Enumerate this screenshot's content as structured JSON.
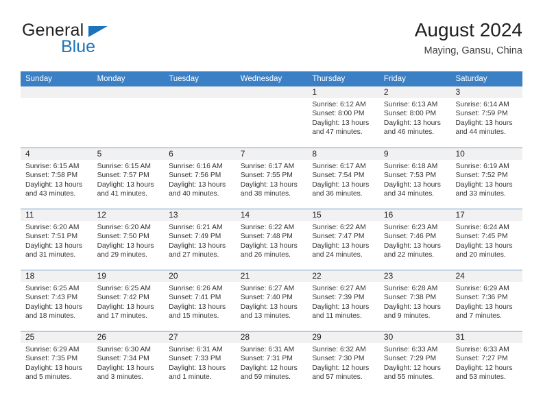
{
  "brand": {
    "name_top": "General",
    "name_bottom": "Blue",
    "flag_color": "#1b74bb"
  },
  "header": {
    "title": "August 2024",
    "subtitle": "Maying, Gansu, China"
  },
  "theme": {
    "header_blue": "#3b7fc4",
    "week_divider": "#6e97c4",
    "daynum_strip": "#f1f1f1"
  },
  "weekdays": [
    "Sunday",
    "Monday",
    "Tuesday",
    "Wednesday",
    "Thursday",
    "Friday",
    "Saturday"
  ],
  "weeks": [
    [
      {
        "day": ""
      },
      {
        "day": ""
      },
      {
        "day": ""
      },
      {
        "day": ""
      },
      {
        "day": "1",
        "sunrise": "Sunrise: 6:12 AM",
        "sunset": "Sunset: 8:00 PM",
        "daylight1": "Daylight: 13 hours",
        "daylight2": "and 47 minutes."
      },
      {
        "day": "2",
        "sunrise": "Sunrise: 6:13 AM",
        "sunset": "Sunset: 8:00 PM",
        "daylight1": "Daylight: 13 hours",
        "daylight2": "and 46 minutes."
      },
      {
        "day": "3",
        "sunrise": "Sunrise: 6:14 AM",
        "sunset": "Sunset: 7:59 PM",
        "daylight1": "Daylight: 13 hours",
        "daylight2": "and 44 minutes."
      }
    ],
    [
      {
        "day": "4",
        "sunrise": "Sunrise: 6:15 AM",
        "sunset": "Sunset: 7:58 PM",
        "daylight1": "Daylight: 13 hours",
        "daylight2": "and 43 minutes."
      },
      {
        "day": "5",
        "sunrise": "Sunrise: 6:15 AM",
        "sunset": "Sunset: 7:57 PM",
        "daylight1": "Daylight: 13 hours",
        "daylight2": "and 41 minutes."
      },
      {
        "day": "6",
        "sunrise": "Sunrise: 6:16 AM",
        "sunset": "Sunset: 7:56 PM",
        "daylight1": "Daylight: 13 hours",
        "daylight2": "and 40 minutes."
      },
      {
        "day": "7",
        "sunrise": "Sunrise: 6:17 AM",
        "sunset": "Sunset: 7:55 PM",
        "daylight1": "Daylight: 13 hours",
        "daylight2": "and 38 minutes."
      },
      {
        "day": "8",
        "sunrise": "Sunrise: 6:17 AM",
        "sunset": "Sunset: 7:54 PM",
        "daylight1": "Daylight: 13 hours",
        "daylight2": "and 36 minutes."
      },
      {
        "day": "9",
        "sunrise": "Sunrise: 6:18 AM",
        "sunset": "Sunset: 7:53 PM",
        "daylight1": "Daylight: 13 hours",
        "daylight2": "and 34 minutes."
      },
      {
        "day": "10",
        "sunrise": "Sunrise: 6:19 AM",
        "sunset": "Sunset: 7:52 PM",
        "daylight1": "Daylight: 13 hours",
        "daylight2": "and 33 minutes."
      }
    ],
    [
      {
        "day": "11",
        "sunrise": "Sunrise: 6:20 AM",
        "sunset": "Sunset: 7:51 PM",
        "daylight1": "Daylight: 13 hours",
        "daylight2": "and 31 minutes."
      },
      {
        "day": "12",
        "sunrise": "Sunrise: 6:20 AM",
        "sunset": "Sunset: 7:50 PM",
        "daylight1": "Daylight: 13 hours",
        "daylight2": "and 29 minutes."
      },
      {
        "day": "13",
        "sunrise": "Sunrise: 6:21 AM",
        "sunset": "Sunset: 7:49 PM",
        "daylight1": "Daylight: 13 hours",
        "daylight2": "and 27 minutes."
      },
      {
        "day": "14",
        "sunrise": "Sunrise: 6:22 AM",
        "sunset": "Sunset: 7:48 PM",
        "daylight1": "Daylight: 13 hours",
        "daylight2": "and 26 minutes."
      },
      {
        "day": "15",
        "sunrise": "Sunrise: 6:22 AM",
        "sunset": "Sunset: 7:47 PM",
        "daylight1": "Daylight: 13 hours",
        "daylight2": "and 24 minutes."
      },
      {
        "day": "16",
        "sunrise": "Sunrise: 6:23 AM",
        "sunset": "Sunset: 7:46 PM",
        "daylight1": "Daylight: 13 hours",
        "daylight2": "and 22 minutes."
      },
      {
        "day": "17",
        "sunrise": "Sunrise: 6:24 AM",
        "sunset": "Sunset: 7:45 PM",
        "daylight1": "Daylight: 13 hours",
        "daylight2": "and 20 minutes."
      }
    ],
    [
      {
        "day": "18",
        "sunrise": "Sunrise: 6:25 AM",
        "sunset": "Sunset: 7:43 PM",
        "daylight1": "Daylight: 13 hours",
        "daylight2": "and 18 minutes."
      },
      {
        "day": "19",
        "sunrise": "Sunrise: 6:25 AM",
        "sunset": "Sunset: 7:42 PM",
        "daylight1": "Daylight: 13 hours",
        "daylight2": "and 17 minutes."
      },
      {
        "day": "20",
        "sunrise": "Sunrise: 6:26 AM",
        "sunset": "Sunset: 7:41 PM",
        "daylight1": "Daylight: 13 hours",
        "daylight2": "and 15 minutes."
      },
      {
        "day": "21",
        "sunrise": "Sunrise: 6:27 AM",
        "sunset": "Sunset: 7:40 PM",
        "daylight1": "Daylight: 13 hours",
        "daylight2": "and 13 minutes."
      },
      {
        "day": "22",
        "sunrise": "Sunrise: 6:27 AM",
        "sunset": "Sunset: 7:39 PM",
        "daylight1": "Daylight: 13 hours",
        "daylight2": "and 11 minutes."
      },
      {
        "day": "23",
        "sunrise": "Sunrise: 6:28 AM",
        "sunset": "Sunset: 7:38 PM",
        "daylight1": "Daylight: 13 hours",
        "daylight2": "and 9 minutes."
      },
      {
        "day": "24",
        "sunrise": "Sunrise: 6:29 AM",
        "sunset": "Sunset: 7:36 PM",
        "daylight1": "Daylight: 13 hours",
        "daylight2": "and 7 minutes."
      }
    ],
    [
      {
        "day": "25",
        "sunrise": "Sunrise: 6:29 AM",
        "sunset": "Sunset: 7:35 PM",
        "daylight1": "Daylight: 13 hours",
        "daylight2": "and 5 minutes."
      },
      {
        "day": "26",
        "sunrise": "Sunrise: 6:30 AM",
        "sunset": "Sunset: 7:34 PM",
        "daylight1": "Daylight: 13 hours",
        "daylight2": "and 3 minutes."
      },
      {
        "day": "27",
        "sunrise": "Sunrise: 6:31 AM",
        "sunset": "Sunset: 7:33 PM",
        "daylight1": "Daylight: 13 hours",
        "daylight2": "and 1 minute."
      },
      {
        "day": "28",
        "sunrise": "Sunrise: 6:31 AM",
        "sunset": "Sunset: 7:31 PM",
        "daylight1": "Daylight: 12 hours",
        "daylight2": "and 59 minutes."
      },
      {
        "day": "29",
        "sunrise": "Sunrise: 6:32 AM",
        "sunset": "Sunset: 7:30 PM",
        "daylight1": "Daylight: 12 hours",
        "daylight2": "and 57 minutes."
      },
      {
        "day": "30",
        "sunrise": "Sunrise: 6:33 AM",
        "sunset": "Sunset: 7:29 PM",
        "daylight1": "Daylight: 12 hours",
        "daylight2": "and 55 minutes."
      },
      {
        "day": "31",
        "sunrise": "Sunrise: 6:33 AM",
        "sunset": "Sunset: 7:27 PM",
        "daylight1": "Daylight: 12 hours",
        "daylight2": "and 53 minutes."
      }
    ]
  ]
}
